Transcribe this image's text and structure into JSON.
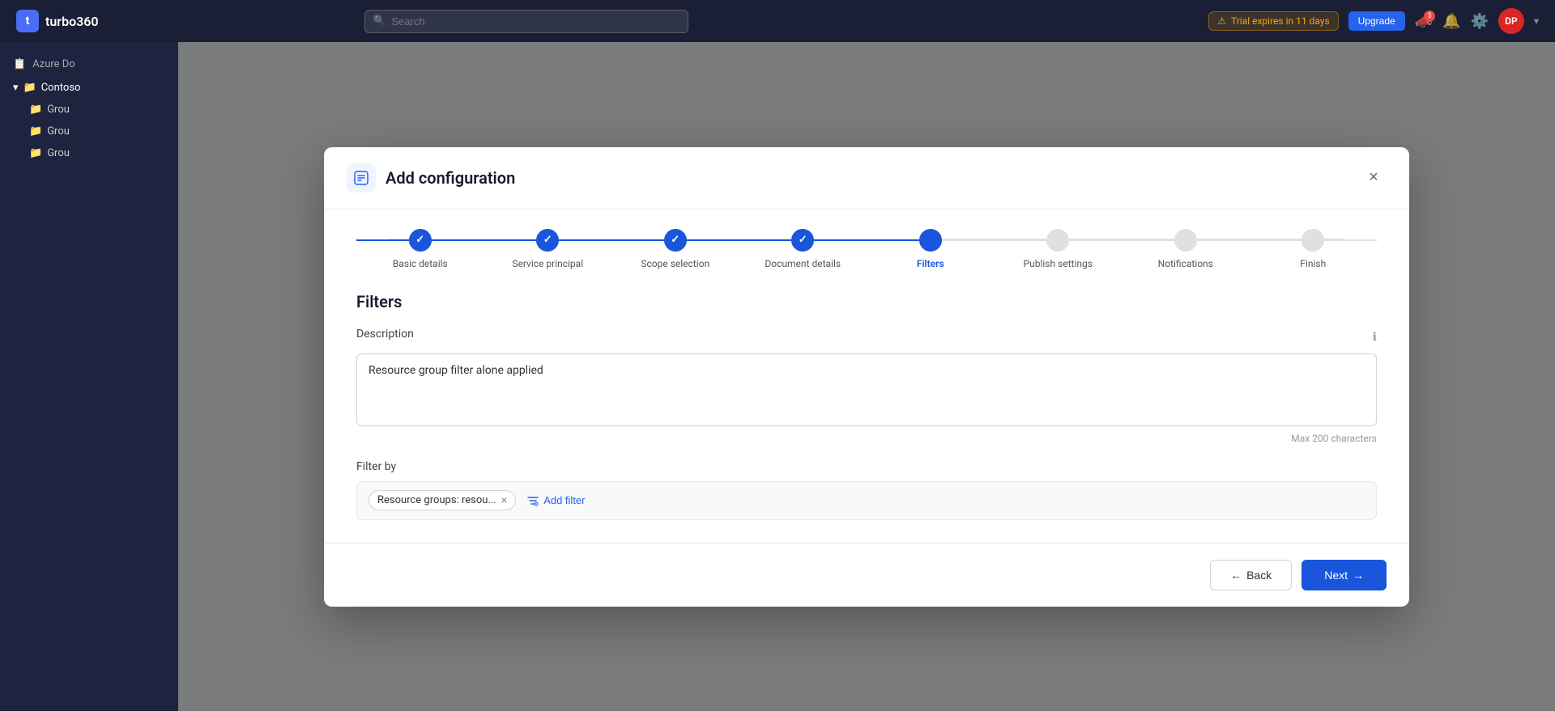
{
  "app": {
    "name": "turbo360",
    "logo_letter": "t"
  },
  "topnav": {
    "search_placeholder": "Search",
    "trial_text": "Trial expires in 11 days",
    "upgrade_label": "Upgrade",
    "user_initials": "DP",
    "notification_count": "5"
  },
  "sidebar": {
    "header_text": "Azure Do",
    "items": [
      {
        "label": "Contoso",
        "type": "parent"
      },
      {
        "label": "Grou",
        "type": "child"
      },
      {
        "label": "Grou",
        "type": "child"
      },
      {
        "label": "Grou",
        "type": "child"
      }
    ]
  },
  "modal": {
    "title": "Add configuration",
    "close_label": "×",
    "steps": [
      {
        "label": "Basic details",
        "state": "completed"
      },
      {
        "label": "Service principal",
        "state": "completed"
      },
      {
        "label": "Scope selection",
        "state": "completed"
      },
      {
        "label": "Document details",
        "state": "completed"
      },
      {
        "label": "Filters",
        "state": "active"
      },
      {
        "label": "Publish settings",
        "state": "pending"
      },
      {
        "label": "Notifications",
        "state": "pending"
      },
      {
        "label": "Finish",
        "state": "pending"
      }
    ],
    "section_title": "Filters",
    "description_label": "Description",
    "description_value": "Resource group filter alone applied",
    "char_limit_text": "Max 200 characters",
    "filter_by_label": "Filter by",
    "filter_chip_label": "Resource groups: resou...",
    "add_filter_label": "Add filter",
    "info_tooltip": "Info",
    "back_label": "← Back",
    "next_label": "Next →"
  }
}
